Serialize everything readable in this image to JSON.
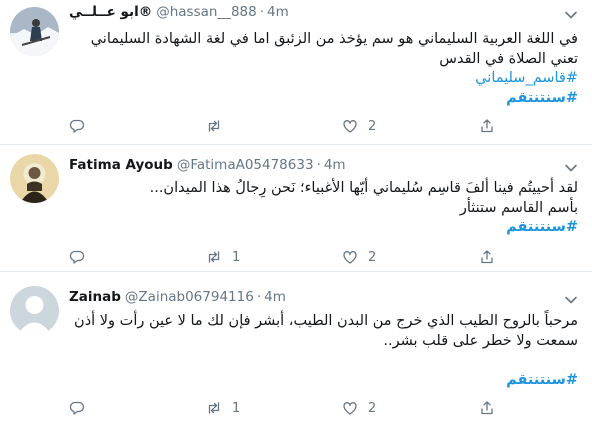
{
  "tweets": [
    {
      "name": "ابو عــلــي®",
      "handle": "@hassan__888",
      "dot": "·",
      "time": "4m",
      "lines": [
        "في اللغة العربية السليماني هو سم يؤخذ من الزئبق اما في لغة الشهادة السليماني",
        "تعني الصلاة في القدس"
      ],
      "tag_lines": [
        "#قاسم_سليماني"
      ],
      "bold_tag": "#سنتنتقم",
      "replies": "",
      "retweets": "",
      "likes": "2"
    },
    {
      "name": "Fatima Ayoub",
      "handle": "@FatimaA05478633",
      "dot": "·",
      "time": "4m",
      "lines": [
        "لقد أحييتُم فينا ألفَ قاسِم سُليماني أيّها الأغبياء؛ نَحن رِجالُ هذا الميدان...",
        "بأسم القاسم ستنثأر"
      ],
      "tag_lines": [],
      "bold_tag": "#سنتنتقم",
      "replies": "",
      "retweets": "1",
      "likes": "2"
    },
    {
      "name": "Zainab",
      "handle": "@Zainab06794116",
      "dot": "·",
      "time": "4m",
      "lines": [
        "مرحباً بالروح الطيب الذي خرج من البدن الطيب، أبشر فإن لك ما لا عين رأت ولا أذن",
        "سمعت ولا خطر على قلب بشر.."
      ],
      "tag_lines": [],
      "bold_tag": "#سنتنتقم",
      "replies": "",
      "retweets": "1",
      "likes": "2"
    }
  ],
  "icons": {
    "reply": "reply-icon",
    "retweet": "retweet-icon",
    "like": "like-icon",
    "share": "share-icon",
    "caret": "chevron-down-icon"
  },
  "colors": {
    "link": "#1b95e0",
    "secondary_text": "#657786",
    "divider": "#e6ecf0"
  }
}
